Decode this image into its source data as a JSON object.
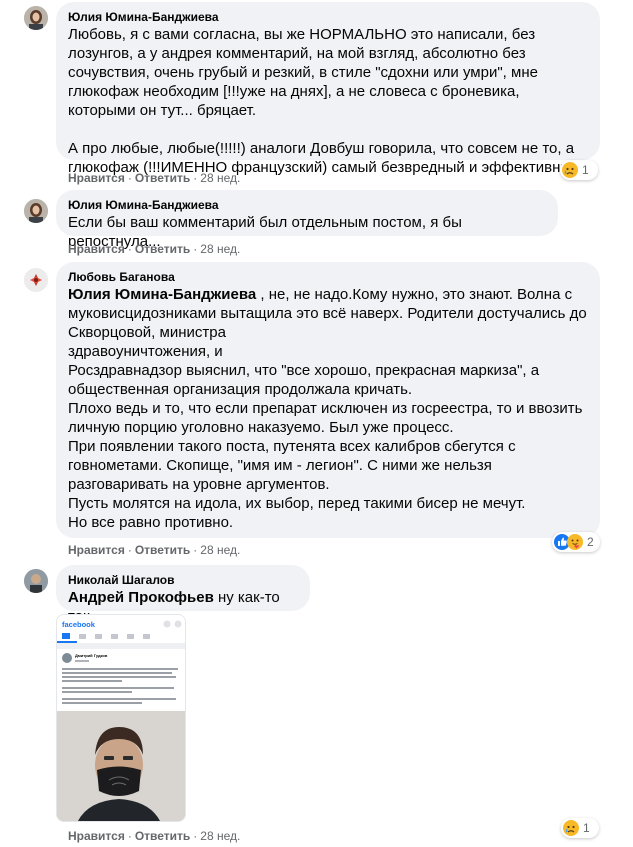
{
  "comments": [
    {
      "author": "Юлия Юмина-Банджиева",
      "paragraphs": [
        "Любовь, я с вами согласна, вы же НОРМАЛЬНО это написали, без лозунгов, а у андрея комментарий, на мой взгляд, абсолютно без сочувствия, очень грубый и резкий, в стиле \"сдохни или умри\", мне глюкофаж необходим [!!!уже на днях], а не словеса с броневика, которыми он тут... бряцает.",
        "А про любые, любые(!!!!!) аналоги Довбуш говорила, что совсем не то, а глюкофаж (!!!ИМЕННО французский) самый безвредный и эффективный!"
      ],
      "like_label": "Нравится",
      "reply_label": "Ответить",
      "time": "28 нед.",
      "reaction_count": "1"
    },
    {
      "author": "Юлия Юмина-Банджиева",
      "paragraphs": [
        "Если бы ваш комментарий был отдельным постом, я бы репостнула..."
      ],
      "like_label": "Нравится",
      "reply_label": "Ответить",
      "time": "28 нед."
    },
    {
      "author": "Любовь Баганова",
      "mention": "Юлия Юмина-Банджиева",
      "lines": [
        " , не, не надо.Кому нужно, это знают. Волна с муковисцидозниками вытащила это всё наверх. Родители достучались до Скворцовой, министра",
        "здравоуничтожения, и",
        "Росздравнадзор выяснил, что \"все хорошо, прекрасная маркиза\", а общественная организация продолжала кричать.",
        "Плохо ведь и то, что если препарат исключен из госреестра, то и ввозить личную порцию уголовно наказуемо. Был уже процесс.",
        "При появлении такого поста, путенята всех калибров сбегутся с говнометами. Скопище, \"имя им - легион\". С ними же нельзя разговаривать на уровне аргументов.",
        "Пусть молятся на идола, их выбор, перед такими бисер не мечут.",
        "Но все равно противно."
      ],
      "like_label": "Нравится",
      "reply_label": "Ответить",
      "time": "28 нед.",
      "reaction_count": "2"
    },
    {
      "author": "Николай Шагалов",
      "mention": "Андрей Прокофьев",
      "text": " ну как-то так,",
      "like_label": "Нравится",
      "reply_label": "Ответить",
      "time": "28 нед.",
      "reaction_count": "1",
      "attachment": {
        "brand": "facebook",
        "post_author": "Дмитрий Гудков"
      }
    }
  ],
  "separator": "·",
  "colors": {
    "bubble": "#f0f2f5",
    "meta": "#65676b",
    "fb_blue": "#1877f2",
    "sad": "#f7b928"
  }
}
